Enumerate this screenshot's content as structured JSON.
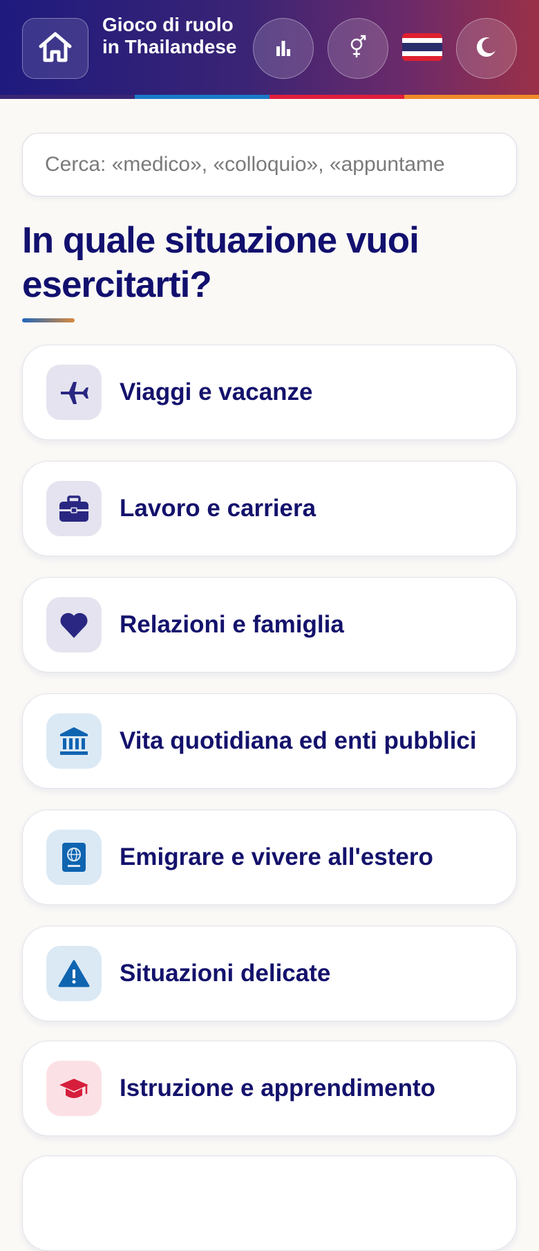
{
  "header": {
    "title": "Gioco di ruolo in Thailandese",
    "home_icon": "home-icon",
    "stats_icon": "bar-chart-icon",
    "gender_icon": "gender-icon",
    "flag": "thailand-flag",
    "theme_icon": "moon-icon",
    "stripe_colors": [
      "#3a2475",
      "#1a7bc8",
      "#e01e3c",
      "#f08a2a"
    ]
  },
  "search": {
    "placeholder": "Cerca: «medico», «colloquio», «appuntame",
    "value": ""
  },
  "page": {
    "title": "In quale situazione vuoi esercitarti?"
  },
  "categories": [
    {
      "label": "Viaggi e vacanze",
      "icon": "airplane-icon",
      "icon_bg": "#e4e3ef",
      "icon_color": "#2a2782"
    },
    {
      "label": "Lavoro e carriera",
      "icon": "briefcase-icon",
      "icon_bg": "#e4e3ef",
      "icon_color": "#2a2782"
    },
    {
      "label": "Relazioni e famiglia",
      "icon": "heart-icon",
      "icon_bg": "#e4e3ef",
      "icon_color": "#2a2782"
    },
    {
      "label": "Vita quotidiana ed enti pubblici",
      "icon": "bank-icon",
      "icon_bg": "#dbe9f5",
      "icon_color": "#0f64b0"
    },
    {
      "label": "Emigrare e vivere all'estero",
      "icon": "passport-icon",
      "icon_bg": "#dbe9f5",
      "icon_color": "#0f64b0"
    },
    {
      "label": "Situazioni delicate",
      "icon": "warning-icon",
      "icon_bg": "#dbe9f5",
      "icon_color": "#0f64b0"
    },
    {
      "label": "Istruzione e apprendimento",
      "icon": "graduation-cap-icon",
      "icon_bg": "#fbe1e5",
      "icon_color": "#d61f3c"
    }
  ]
}
